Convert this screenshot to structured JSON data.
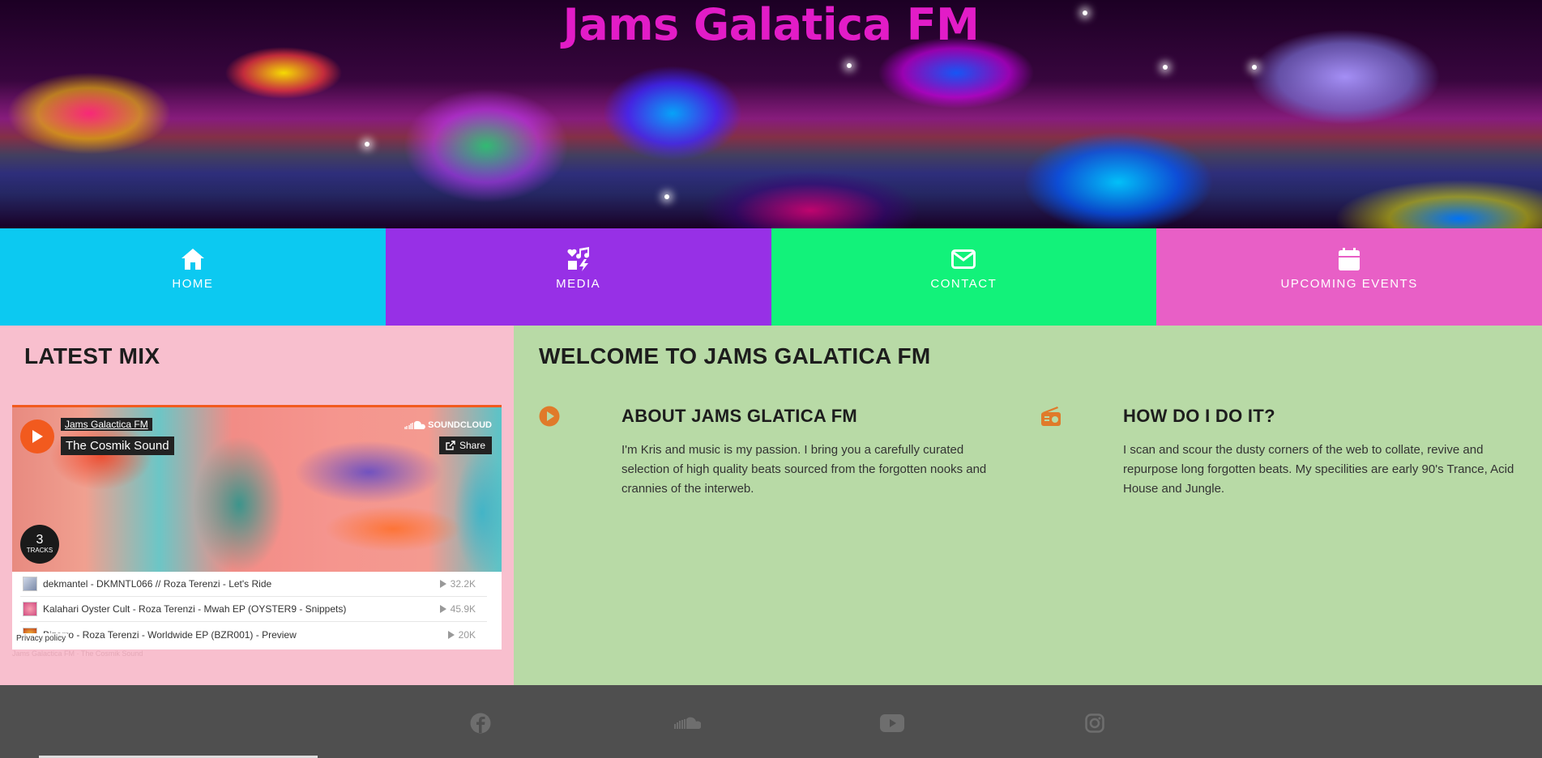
{
  "hero": {
    "title": "Jams Galatica FM"
  },
  "nav": {
    "items": [
      {
        "label": "HOME",
        "icon": "home-icon",
        "color": "#0cc9f1"
      },
      {
        "label": "MEDIA",
        "icon": "music-media-icon",
        "color": "#9730e6"
      },
      {
        "label": "CONTACT",
        "icon": "envelope-icon",
        "color": "#12f27a"
      },
      {
        "label": "UPCOMING EVENTS",
        "icon": "calendar-icon",
        "color": "#e85fc6"
      }
    ]
  },
  "latest_mix": {
    "heading": "LATEST MIX",
    "player": {
      "user": "Jams Galactica FM",
      "title": "The Cosmik Sound",
      "brand": "SOUNDCLOUD",
      "share_label": "Share",
      "track_count": "3",
      "track_count_label": "TRACKS",
      "tracks": [
        {
          "name": "dekmantel - DKMNTL066 // Roza Terenzi - Let's Ride",
          "plays": "32.2K"
        },
        {
          "name": "Kalahari Oyster Cult - Roza Terenzi - Mwah EP (OYSTER9 - Snippets)",
          "plays": "45.9K"
        },
        {
          "name": "Bizarro - Roza Terenzi - Worldwide EP (BZR001) - Preview",
          "plays": "20K"
        }
      ],
      "privacy_label": "Privacy policy",
      "footer_text": "Jams Galactica FM · The Cosmik Sound"
    }
  },
  "welcome": {
    "heading": "WELCOME TO JAMS GALATICA FM",
    "features": [
      {
        "icon": "play-circle-icon",
        "title": "ABOUT JAMS GLATICA FM",
        "text": "I'm Kris and music is my passion. I bring you a carefully curated selection of high quality beats sourced from the forgotten nooks and crannies of the interweb."
      },
      {
        "icon": "radio-icon",
        "title": "HOW DO I DO IT?",
        "text": "I scan and scour the dusty corners of the web to collate, revive and repurpose long forgotten beats. My specilities are early 90's Trance, Acid House and Jungle."
      }
    ],
    "accent_color": "#e07a2a"
  },
  "footer": {
    "social": [
      {
        "icon": "facebook-icon"
      },
      {
        "icon": "soundcloud-icon"
      },
      {
        "icon": "youtube-icon"
      },
      {
        "icon": "instagram-icon"
      }
    ]
  }
}
